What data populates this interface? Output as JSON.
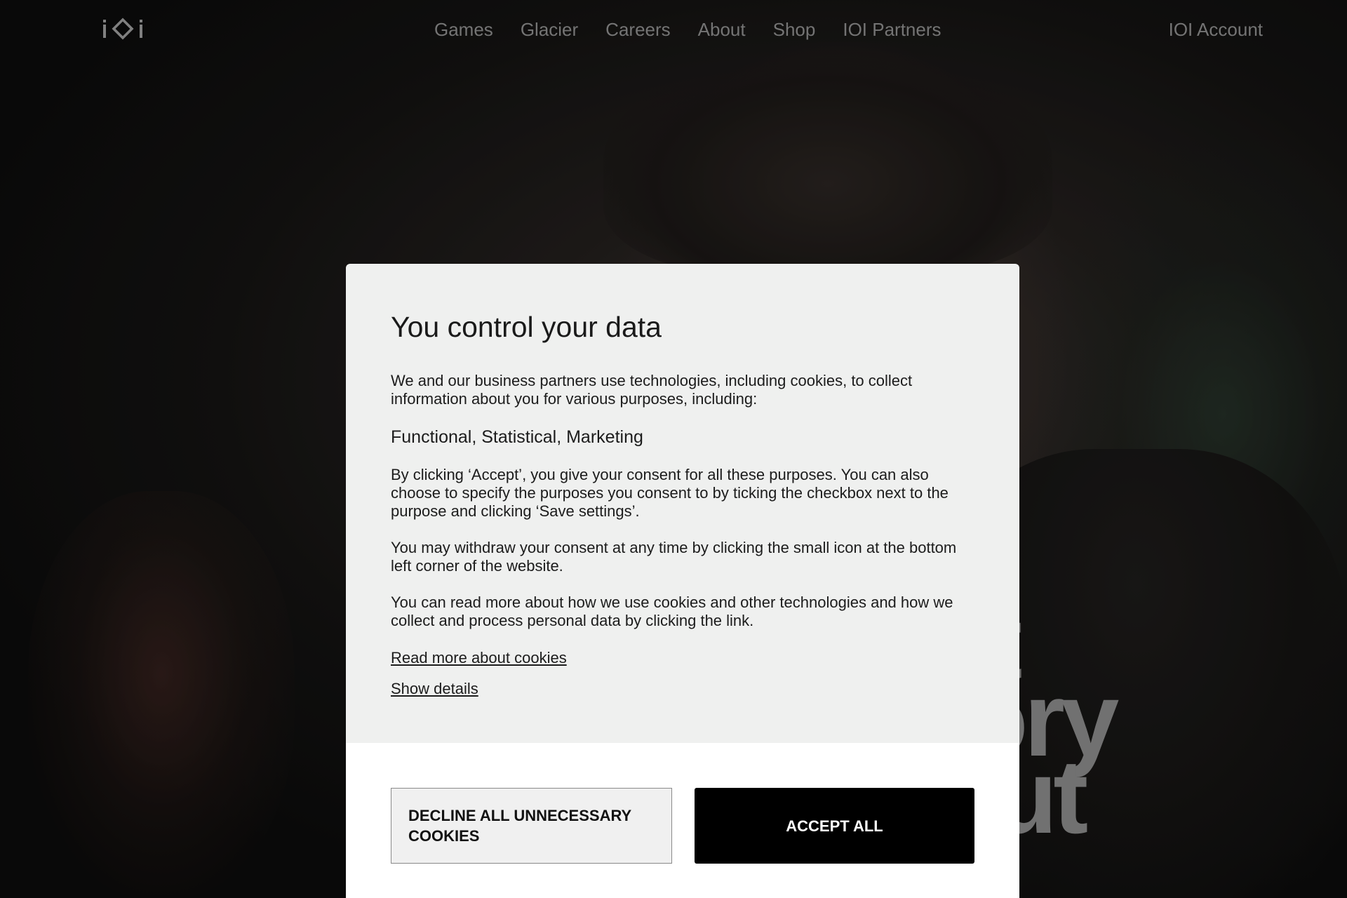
{
  "nav": {
    "logo_text": "IOI",
    "links": [
      {
        "label": "Games"
      },
      {
        "label": "Glacier"
      },
      {
        "label": "Careers"
      },
      {
        "label": "About"
      },
      {
        "label": "Shop"
      },
      {
        "label": "IOI Partners"
      }
    ],
    "account_label": "IOI Account"
  },
  "hero": {
    "lines": [
      "st",
      "tory",
      "out"
    ]
  },
  "consent": {
    "title": "You control your data",
    "intro": "We and our business partners use technologies, including cookies, to collect information about you for various purposes, including:",
    "purposes": "Functional, Statistical, Marketing",
    "accept_info": "By clicking ‘Accept’, you give your consent for all these purposes. You can also choose to specify the purposes you consent to by ticking the checkbox next to the purpose and clicking ‘Save settings’.",
    "withdraw_info": "You may withdraw your consent at any time by clicking the small icon at the bottom left corner of the website.",
    "read_more_info": "You can read more about how we use cookies and other technologies and how we collect and process personal data by clicking the link.",
    "read_more_link": "Read more about cookies",
    "show_details_link": "Show details",
    "decline_button": "DECLINE ALL UNNECESSARY COOKIES",
    "accept_button": "ACCEPT ALL"
  },
  "colors": {
    "modal_bg": "#eff0ef",
    "footer_bg": "#ffffff",
    "accept_bg": "#000000",
    "nav_text": "#8e8e8e"
  }
}
